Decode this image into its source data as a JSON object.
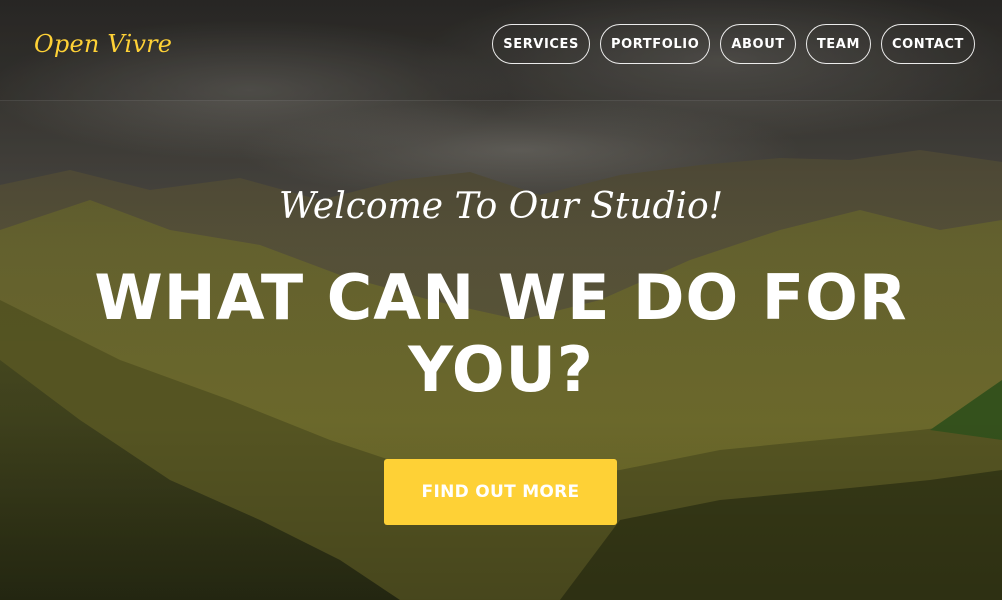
{
  "brand": {
    "name": "Open Vivre",
    "color": "#fed136"
  },
  "nav": {
    "items": [
      {
        "label": "SERVICES"
      },
      {
        "label": "PORTFOLIO"
      },
      {
        "label": "ABOUT"
      },
      {
        "label": "TEAM"
      },
      {
        "label": "CONTACT"
      }
    ]
  },
  "hero": {
    "lead": "Welcome To Our Studio!",
    "heading": "WHAT CAN WE DO FOR YOU?",
    "cta_label": "FIND OUT MORE",
    "cta_color": "#fed136",
    "background": "mountain-valley-photo"
  }
}
